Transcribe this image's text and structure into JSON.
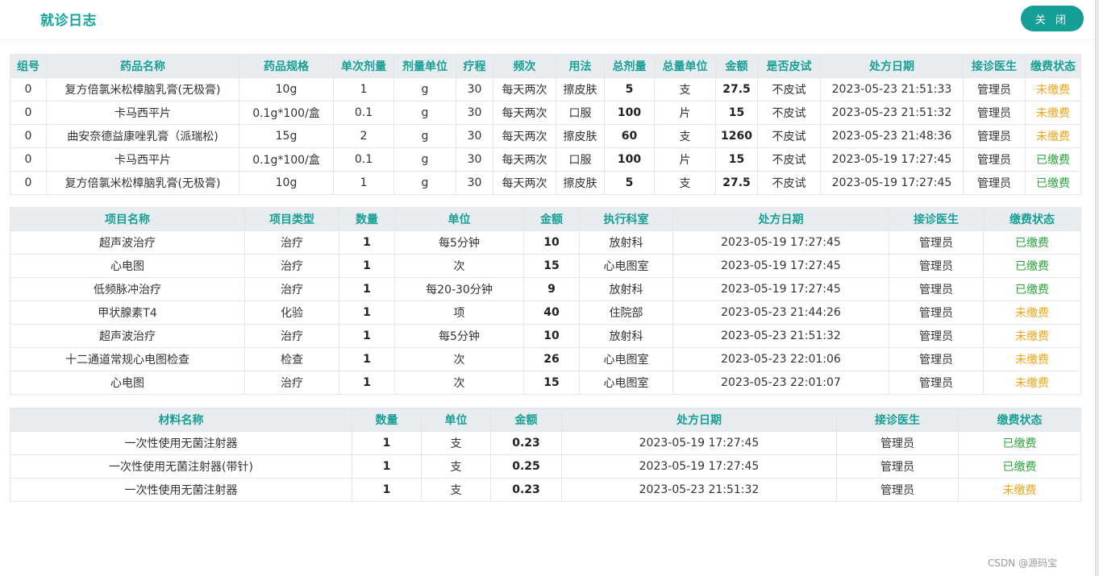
{
  "header": {
    "title": "就诊日志",
    "close_label": "关 闭"
  },
  "drugs": {
    "columns": [
      "组号",
      "药品名称",
      "药品规格",
      "单次剂量",
      "剂量单位",
      "疗程",
      "频次",
      "用法",
      "总剂量",
      "总量单位",
      "金额",
      "是否皮试",
      "处方日期",
      "接诊医生",
      "缴费状态"
    ],
    "rows": [
      [
        "0",
        "复方倍氯米松樟脑乳膏(无极膏)",
        "10g",
        "1",
        "g",
        "30",
        "每天两次",
        "擦皮肤",
        "5",
        "支",
        "27.5",
        "不皮试",
        "2023-05-23 21:51:33",
        "管理员",
        "未缴费"
      ],
      [
        "0",
        "卡马西平片",
        "0.1g*100/盒",
        "0.1",
        "g",
        "30",
        "每天两次",
        "口服",
        "100",
        "片",
        "15",
        "不皮试",
        "2023-05-23 21:51:32",
        "管理员",
        "未缴费"
      ],
      [
        "0",
        "曲安奈德益康唑乳膏（派瑞松)",
        "15g",
        "2",
        "g",
        "30",
        "每天两次",
        "擦皮肤",
        "60",
        "支",
        "1260",
        "不皮试",
        "2023-05-23 21:48:36",
        "管理员",
        "未缴费"
      ],
      [
        "0",
        "卡马西平片",
        "0.1g*100/盒",
        "0.1",
        "g",
        "30",
        "每天两次",
        "口服",
        "100",
        "片",
        "15",
        "不皮试",
        "2023-05-19 17:27:45",
        "管理员",
        "已缴费"
      ],
      [
        "0",
        "复方倍氯米松樟脑乳膏(无极膏)",
        "10g",
        "1",
        "g",
        "30",
        "每天两次",
        "擦皮肤",
        "5",
        "支",
        "27.5",
        "不皮试",
        "2023-05-19 17:27:45",
        "管理员",
        "已缴费"
      ]
    ]
  },
  "items": {
    "columns": [
      "项目名称",
      "项目类型",
      "数量",
      "单位",
      "金额",
      "执行科室",
      "处方日期",
      "接诊医生",
      "缴费状态"
    ],
    "rows": [
      [
        "超声波治疗",
        "治疗",
        "1",
        "每5分钟",
        "10",
        "放射科",
        "2023-05-19 17:27:45",
        "管理员",
        "已缴费"
      ],
      [
        "心电图",
        "治疗",
        "1",
        "次",
        "15",
        "心电图室",
        "2023-05-19 17:27:45",
        "管理员",
        "已缴费"
      ],
      [
        "低频脉冲治疗",
        "治疗",
        "1",
        "每20-30分钟",
        "9",
        "放射科",
        "2023-05-19 17:27:45",
        "管理员",
        "已缴费"
      ],
      [
        "甲状腺素T4",
        "化验",
        "1",
        "项",
        "40",
        "住院部",
        "2023-05-23 21:44:26",
        "管理员",
        "未缴费"
      ],
      [
        "超声波治疗",
        "治疗",
        "1",
        "每5分钟",
        "10",
        "放射科",
        "2023-05-23 21:51:32",
        "管理员",
        "未缴费"
      ],
      [
        "十二通道常规心电图检查",
        "检查",
        "1",
        "次",
        "26",
        "心电图室",
        "2023-05-23 22:01:06",
        "管理员",
        "未缴费"
      ],
      [
        "心电图",
        "治疗",
        "1",
        "次",
        "15",
        "心电图室",
        "2023-05-23 22:01:07",
        "管理员",
        "未缴费"
      ]
    ]
  },
  "materials": {
    "columns": [
      "材料名称",
      "数量",
      "单位",
      "金额",
      "处方日期",
      "接诊医生",
      "缴费状态"
    ],
    "rows": [
      [
        "一次性使用无菌注射器",
        "1",
        "支",
        "0.23",
        "2023-05-19 17:27:45",
        "管理员",
        "已缴费"
      ],
      [
        "一次性使用无菌注射器(带针)",
        "1",
        "支",
        "0.25",
        "2023-05-19 17:27:45",
        "管理员",
        "已缴费"
      ],
      [
        "一次性使用无菌注射器",
        "1",
        "支",
        "0.23",
        "2023-05-23 21:51:32",
        "管理员",
        "未缴费"
      ]
    ]
  },
  "status_values": {
    "paid": "已缴费",
    "unpaid": "未缴费"
  },
  "colors": {
    "accent": "#15a39a",
    "paid": "#2aa33b",
    "unpaid": "#f0a419",
    "header_bg": "#e8ecef"
  },
  "watermark": "CSDN @源码宝"
}
